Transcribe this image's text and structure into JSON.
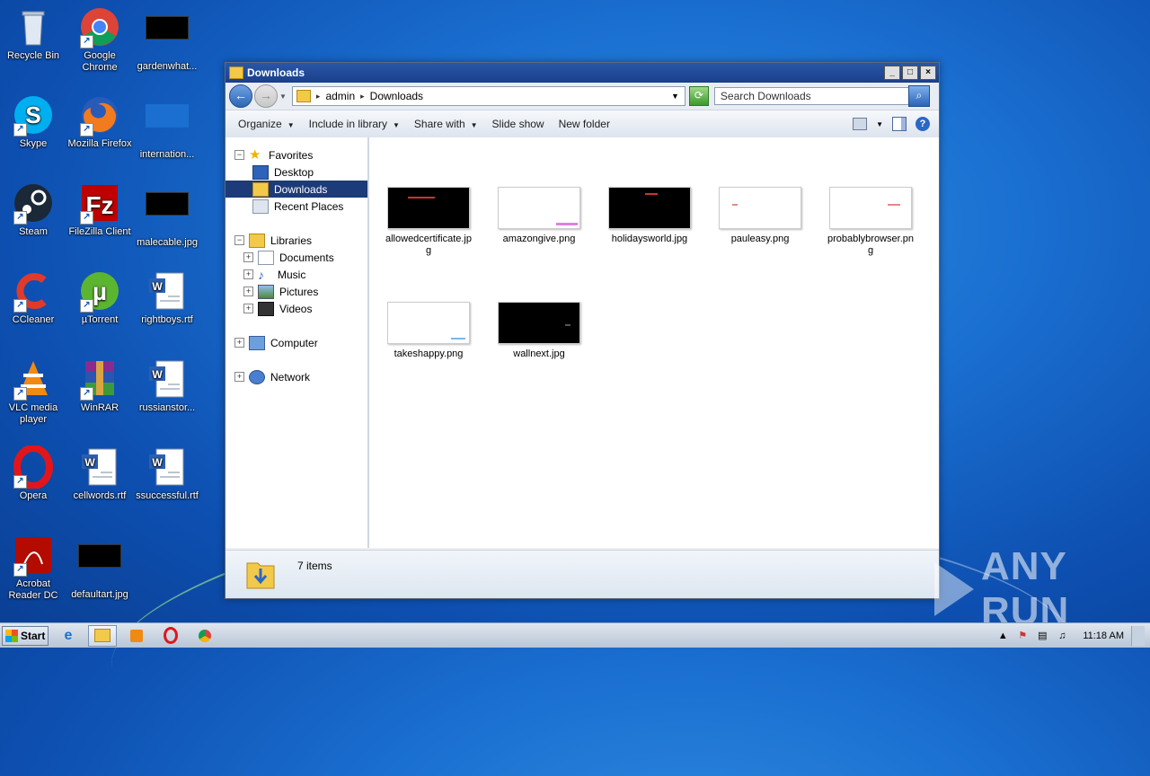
{
  "desktop": {
    "icons": [
      {
        "label": "Recycle Bin"
      },
      {
        "label": "Google Chrome"
      },
      {
        "label": "gardenwhat..."
      },
      {
        "label": "Skype"
      },
      {
        "label": "Mozilla Firefox"
      },
      {
        "label": "internation..."
      },
      {
        "label": "Steam"
      },
      {
        "label": "FileZilla Client"
      },
      {
        "label": "malecable.jpg"
      },
      {
        "label": "CCleaner"
      },
      {
        "label": "µTorrent"
      },
      {
        "label": "rightboys.rtf"
      },
      {
        "label": "VLC media player"
      },
      {
        "label": "WinRAR"
      },
      {
        "label": "russianstor..."
      },
      {
        "label": "Opera"
      },
      {
        "label": "cellwords.rtf"
      },
      {
        "label": "ssuccessful.rtf"
      },
      {
        "label": "Acrobat Reader DC"
      },
      {
        "label": "defaultart.jpg"
      }
    ]
  },
  "window": {
    "title": "Downloads",
    "address": {
      "crumbs": [
        "admin",
        "Downloads"
      ]
    },
    "search_placeholder": "Search Downloads",
    "toolbar": {
      "organize": "Organize",
      "include": "Include in library",
      "share": "Share with",
      "slideshow": "Slide show",
      "newfolder": "New folder"
    },
    "nav": {
      "favorites": "Favorites",
      "desktop": "Desktop",
      "downloads": "Downloads",
      "recent": "Recent Places",
      "libraries": "Libraries",
      "documents": "Documents",
      "music": "Music",
      "pictures": "Pictures",
      "videos": "Videos",
      "computer": "Computer",
      "network": "Network"
    },
    "files": [
      {
        "name": "allowedcertificate.jpg",
        "thumb": "black"
      },
      {
        "name": "amazongive.png",
        "thumb": "white"
      },
      {
        "name": "holidaysworld.jpg",
        "thumb": "black"
      },
      {
        "name": "pauleasy.png",
        "thumb": "white"
      },
      {
        "name": "probablybrowser.png",
        "thumb": "white"
      },
      {
        "name": "takeshappy.png",
        "thumb": "white"
      },
      {
        "name": "wallnext.jpg",
        "thumb": "black"
      }
    ],
    "status": {
      "count": "7 items"
    }
  },
  "taskbar": {
    "start": "Start",
    "clock": "11:18 AM"
  },
  "watermark": {
    "text": "ANY RUN"
  }
}
